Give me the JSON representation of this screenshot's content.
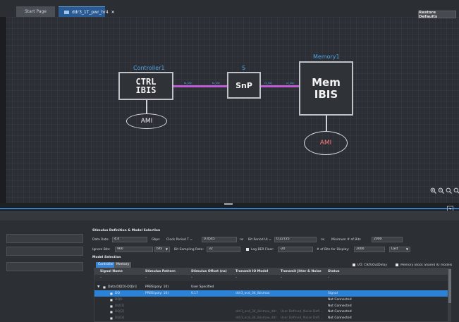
{
  "tabs": {
    "start": "Start Page",
    "active": "ddr3_1T_pwr_hr4",
    "close": "✕"
  },
  "canvas": {
    "controller": {
      "title": "Controller1",
      "body_line1": "CTRL",
      "body_line2": "IBIS",
      "ami": "AMI"
    },
    "snp": {
      "title": "S",
      "body": "SnP"
    },
    "memory": {
      "title": "Memory1",
      "body_line1": "Mem",
      "body_line2": "IBIS",
      "ami": "AMI"
    },
    "wire_color": "#c15bd8",
    "title_color": "#4da6e8",
    "zoom_icons": [
      "zoom-in-icon",
      "zoom-out-icon",
      "zoom-fit-icon",
      "zoom-reset-icon"
    ]
  },
  "panel": {
    "restore_defaults": "Restore Defaults",
    "stimulus_title": "Stimulus Definition & Model Selection",
    "data_rate_label": "Data Rate:",
    "data_rate_value": "4.4",
    "data_rate_unit": "Gbps",
    "clock_period_label": "Clock Period T =",
    "clock_period_value": "0.4545",
    "clock_period_unit": "ns",
    "bit_period_label": "Bit Period UI =",
    "bit_period_value": "0.22725",
    "bit_period_unit": "ns",
    "min_bits_label": "Minimum # of Bits",
    "min_bits_value": "2000",
    "ignore_bits_label": "Ignore Bits:",
    "ignore_bits_value": "960",
    "ignore_bits_unit": "bits",
    "bit_sampling_label": "Bit Sampling Rate:",
    "bit_sampling_value": "32",
    "log_ber_label": "Log BER Floor:",
    "log_ber_value": "-20",
    "bits_display_label": "# of Bits for Display:",
    "bits_display_value": "2000",
    "last_value": "Last",
    "model_selection_title": "Model Selection",
    "subtabs": [
      "Controller",
      "Memory"
    ],
    "option_io_delay": "I/O: ClkToOutDelay",
    "option_mem_block": "Memory Block Shared IO models"
  },
  "table": {
    "headers": [
      "Signal Name",
      "Stimulus Pattern",
      "Stimulus Offset (ns)",
      "Transmit IO Model",
      "Transmit Jitter & Noise",
      "Status"
    ],
    "rows": [
      {
        "name": "Data:DQ[0]-DQ[n]",
        "pattern": "PRBS(poly: 10)",
        "offset": "User Specified",
        "model": "",
        "jitter": "",
        "status": "",
        "dim": false,
        "selected": false
      },
      {
        "name": "DQ",
        "pattern": "PRBS(poly: 10)",
        "offset": "0.17",
        "model": "ddr3_ocd_34_ibismax",
        "jitter": "",
        "status": "Signal",
        "dim": false,
        "selected": true
      },
      {
        "name": "DQ0-",
        "pattern": "",
        "offset": "",
        "model": "",
        "jitter": "",
        "status": "Not Connected",
        "dim": true,
        "selected": false
      },
      {
        "name": "DQ[1]",
        "pattern": "",
        "offset": "",
        "model": "",
        "jitter": "",
        "status": "Not Connected",
        "dim": true,
        "selected": false
      },
      {
        "name": "DQ[2]",
        "pattern": "",
        "offset": "",
        "model": "ddr3_ocd_34_ibismax_ddr",
        "jitter": "User Defined, Noise Defi...",
        "status": "Not Connected",
        "dim": true,
        "selected": false
      },
      {
        "name": "DQ[3]",
        "pattern": "",
        "offset": "",
        "model": "ddr3_ocd_34_ibismax_ddr",
        "jitter": "User Defined, Noise Defi...",
        "status": "Not Connected",
        "dim": true,
        "selected": false
      }
    ]
  }
}
